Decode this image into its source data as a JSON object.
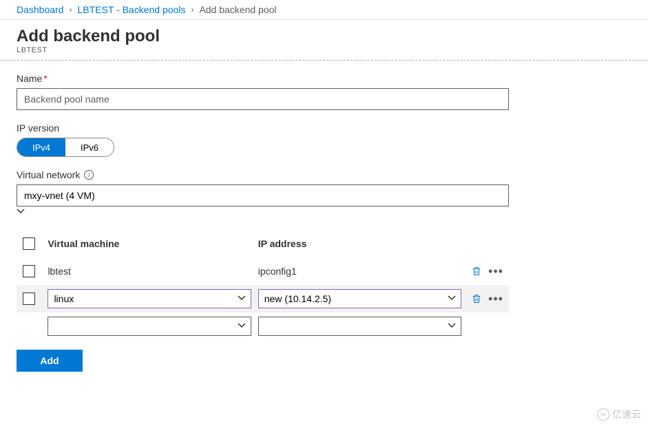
{
  "breadcrumb": {
    "items": [
      "Dashboard",
      "LBTEST - Backend pools",
      "Add backend pool"
    ]
  },
  "header": {
    "title": "Add backend pool",
    "subtitle": "LBTEST"
  },
  "form": {
    "name_label": "Name",
    "name_placeholder": "Backend pool name",
    "name_value": "",
    "ipversion_label": "IP version",
    "ipversion_options": [
      "IPv4",
      "IPv6"
    ],
    "ipversion_selected": "IPv4",
    "vnet_label": "Virtual network",
    "vnet_value": "mxy-vnet (4 VM)"
  },
  "grid": {
    "col_vm": "Virtual machine",
    "col_ip": "IP address",
    "rows": [
      {
        "vm": "lbtest",
        "ip": "ipconfig1",
        "editable": false
      },
      {
        "vm": "linux",
        "ip": "new (10.14.2.5)",
        "editable": true
      },
      {
        "vm": "",
        "ip": "",
        "editable": true,
        "blank": true
      }
    ]
  },
  "add_button": "Add",
  "watermark": "亿速云"
}
